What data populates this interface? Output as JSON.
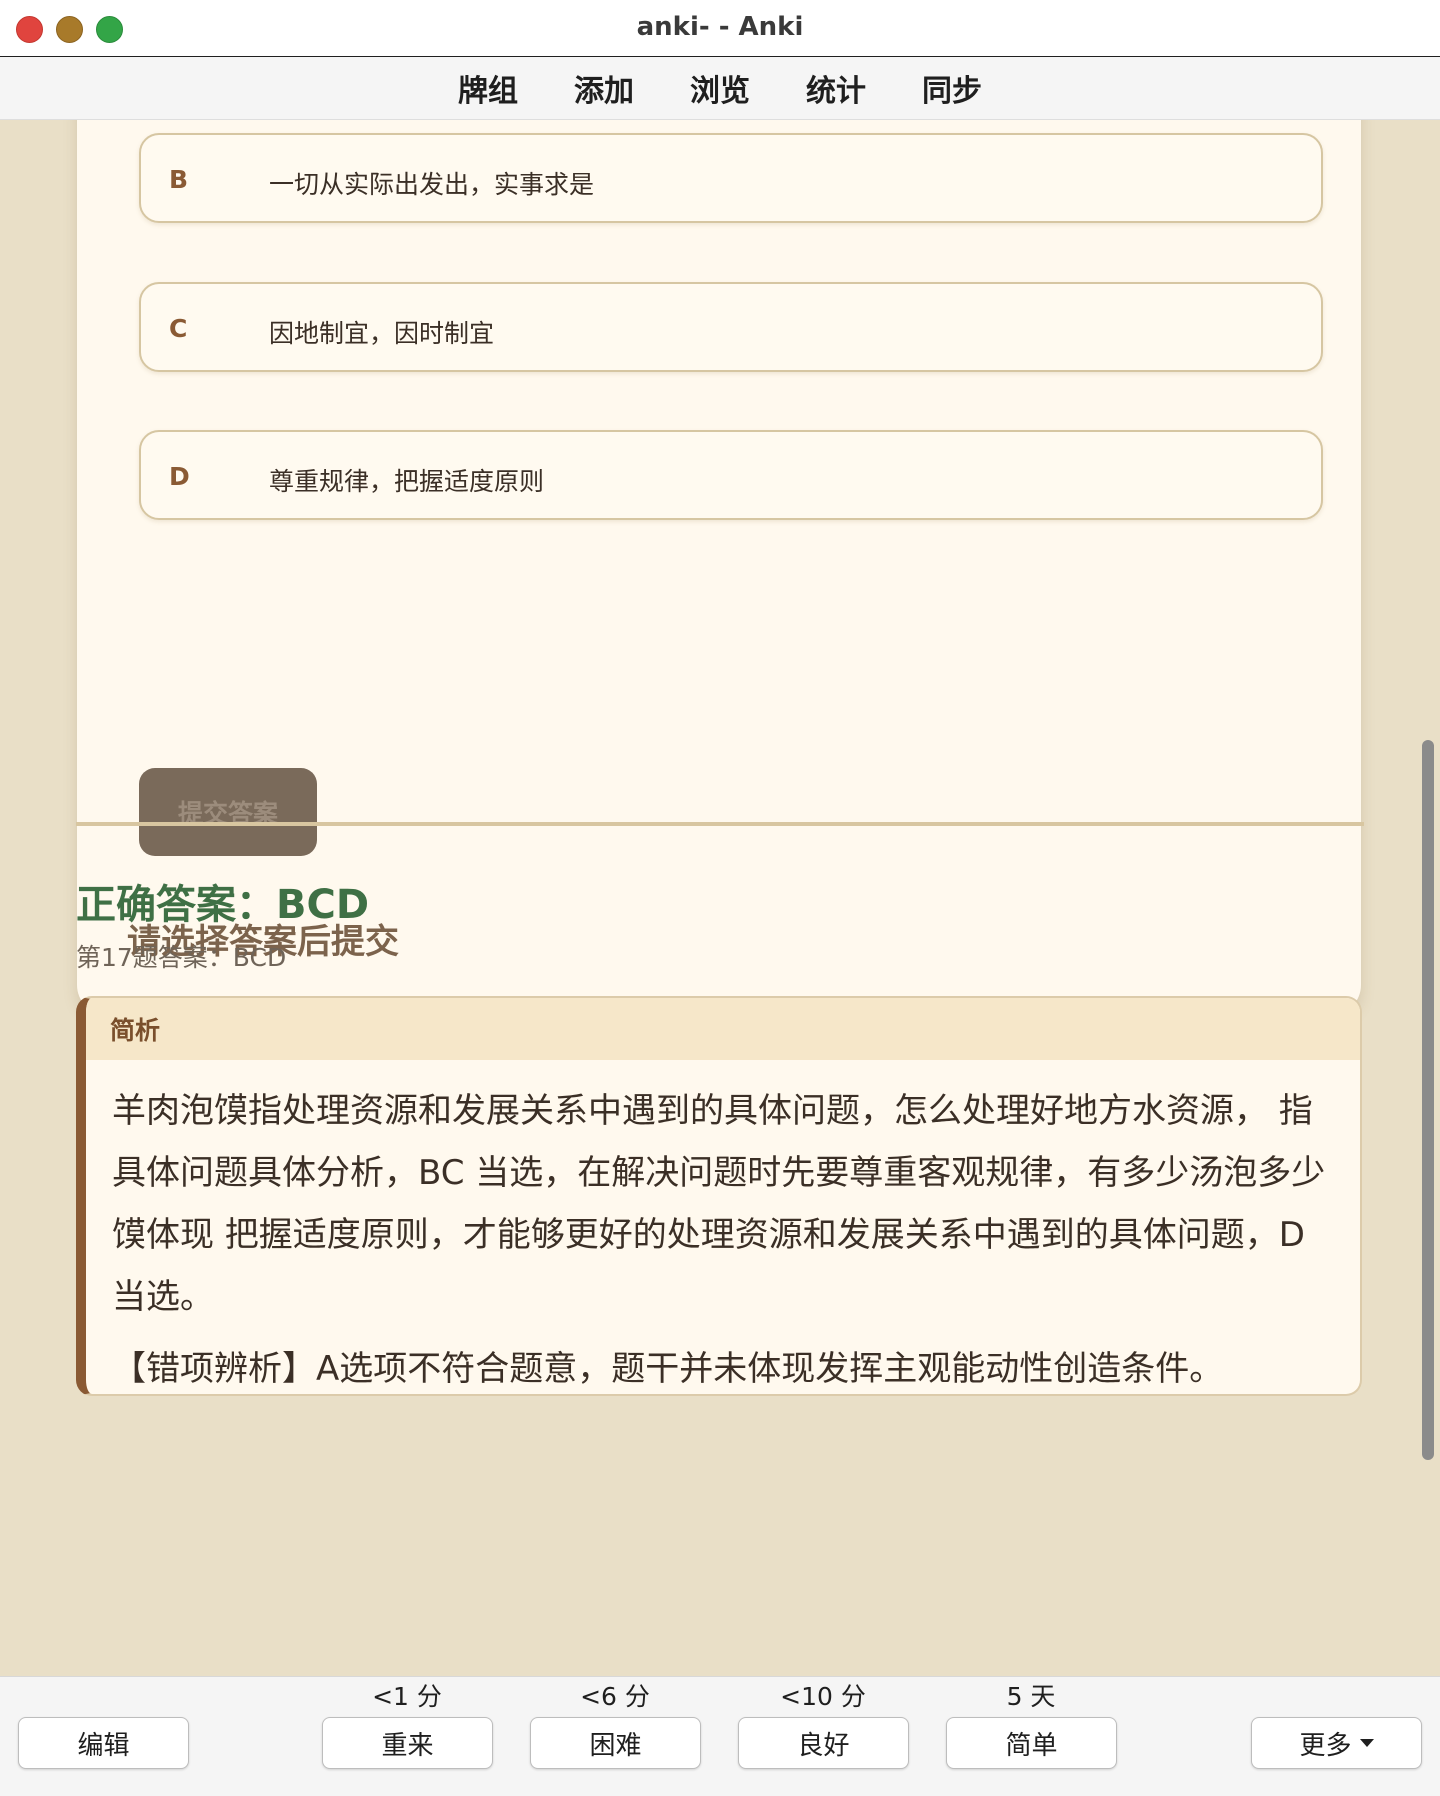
{
  "window": {
    "title": "anki- - Anki"
  },
  "toolbar": {
    "decks": "牌组",
    "add": "添加",
    "browse": "浏览",
    "stats": "统计",
    "sync": "同步"
  },
  "question": {
    "options": [
      {
        "letter": "B",
        "text": "一切从实际出发出，实事求是"
      },
      {
        "letter": "C",
        "text": "因地制宜，因时制宜"
      },
      {
        "letter": "D",
        "text": "尊重规律，把握适度原则"
      }
    ],
    "submit_label": "提交答案",
    "hint": "请选择答案后提交"
  },
  "answer": {
    "title": "正确答案：BCD",
    "line": "第17题答案：BCD",
    "analysis_heading": "简析",
    "analysis_p1": "羊肉泡馍指处理资源和发展关系中遇到的具体问题，怎么处理好地方水资源， 指具体问题具体分析，BC 当选，在解决问题时先要尊重客观规律，有多少汤泡多少馍体现 把握适度原则，才能够更好的处理资源和发展关系中遇到的具体问题，D当选。",
    "analysis_p2": "【错项辨析】A选项不符合题意，题干并未体现发挥主观能动性创造条件。"
  },
  "bottom": {
    "edit": "编辑",
    "again": {
      "label": "重来",
      "interval": "<1 分"
    },
    "hard": {
      "label": "困难",
      "interval": "<6 分"
    },
    "good": {
      "label": "良好",
      "interval": "<10 分"
    },
    "easy": {
      "label": "简单",
      "interval": "5 天"
    },
    "more": "更多"
  }
}
